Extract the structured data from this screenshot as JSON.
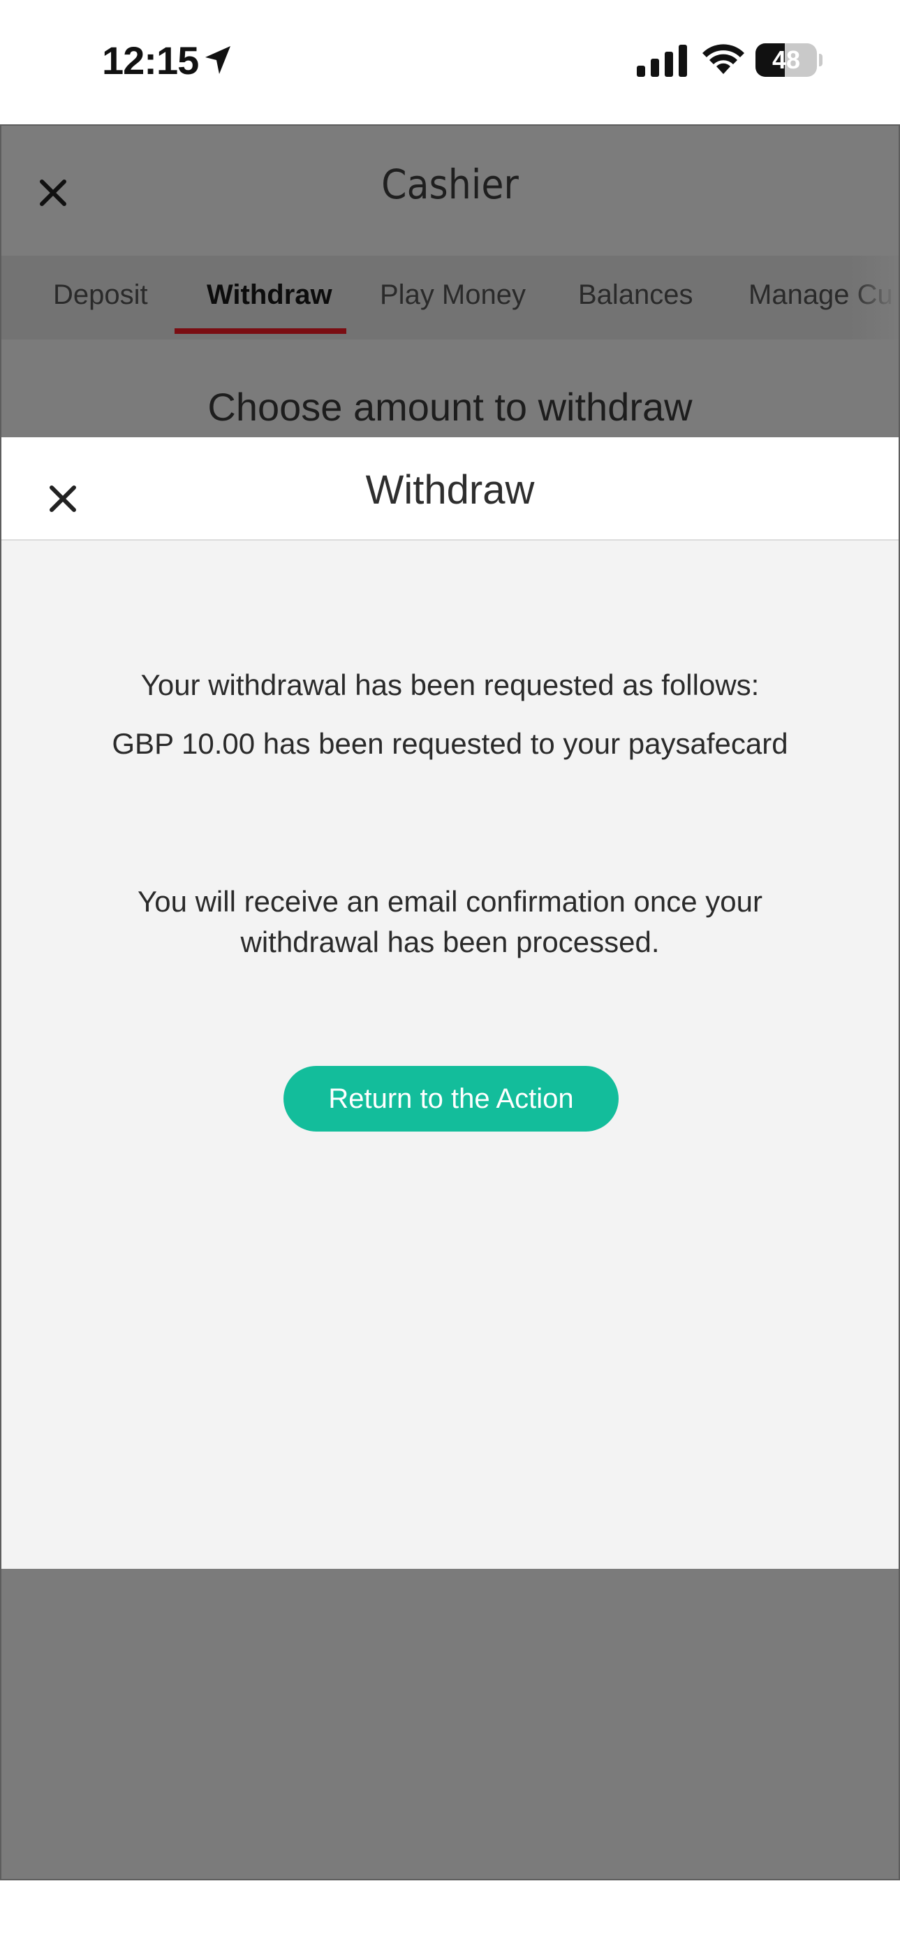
{
  "status_bar": {
    "time": "12:15",
    "battery_level": "48",
    "battery_fraction": 0.48,
    "icons": [
      "location-arrow-icon",
      "cellular-signal-icon",
      "wifi-icon",
      "battery-icon"
    ]
  },
  "cashier": {
    "title": "Cashier",
    "tabs": [
      {
        "label": "Deposit",
        "active": false
      },
      {
        "label": "Withdraw",
        "active": true
      },
      {
        "label": "Play Money",
        "active": false
      },
      {
        "label": "Balances",
        "active": false
      },
      {
        "label": "Manage Cu",
        "active": false
      }
    ],
    "heading": "Choose amount to withdraw",
    "tab_underline_color": "#7a0d12",
    "overlay_color": "#7b7b7b"
  },
  "modal": {
    "title": "Withdraw",
    "line1": "Your withdrawal has been requested as follows:",
    "line2": "GBP 10.00 has been requested to your paysafecard",
    "line3": "You will receive an email confirmation once your withdrawal has been processed.",
    "button_label": "Return to the Action",
    "button_color": "#13bd9b"
  }
}
